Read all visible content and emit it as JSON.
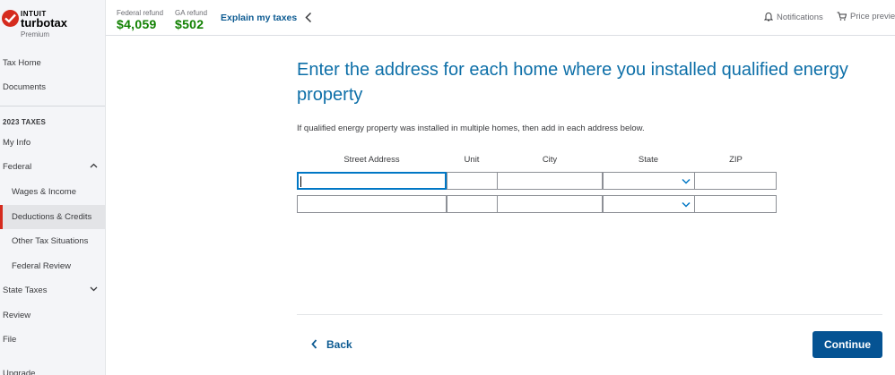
{
  "brand": {
    "company": "INTUIT",
    "product": "turbotax",
    "edition": "Premium"
  },
  "header": {
    "federal_refund_label": "Federal refund",
    "federal_refund_amount": "$4,059",
    "state_refund_label": "GA refund",
    "state_refund_amount": "$502",
    "explain_link": "Explain my taxes",
    "notifications": "Notifications",
    "price_preview": "Price preview"
  },
  "sidebar": {
    "tax_home": "Tax Home",
    "documents": "Documents",
    "section_heading": "2023 TAXES",
    "my_info": "My Info",
    "federal": "Federal",
    "wages_income": "Wages & Income",
    "deductions_credits": "Deductions & Credits",
    "other_tax_situations": "Other Tax Situations",
    "federal_review": "Federal Review",
    "state_taxes": "State Taxes",
    "review": "Review",
    "file": "File",
    "upgrade": "Upgrade"
  },
  "main": {
    "title": "Enter the address for each home where you installed qualified energy property",
    "instructions": "If qualified energy property was installed in multiple homes, then add in each address below.",
    "columns": {
      "street": "Street Address",
      "unit": "Unit",
      "city": "City",
      "state": "State",
      "zip": "ZIP"
    },
    "rows": [
      {
        "street": "",
        "unit": "",
        "city": "",
        "state": "",
        "zip": ""
      },
      {
        "street": "",
        "unit": "",
        "city": "",
        "state": "",
        "zip": ""
      }
    ]
  },
  "footer": {
    "back": "Back",
    "continue": "Continue"
  },
  "colors": {
    "brand_red": "#d52b1e",
    "refund_green": "#108000",
    "link_blue": "#0d5b92",
    "primary_button": "#055393",
    "title_blue": "#0d6fa8"
  },
  "icons": [
    "checkmark-logo-icon",
    "chevron-left-icon",
    "bell-icon",
    "cart-icon",
    "chevron-up-icon",
    "chevron-down-icon"
  ]
}
